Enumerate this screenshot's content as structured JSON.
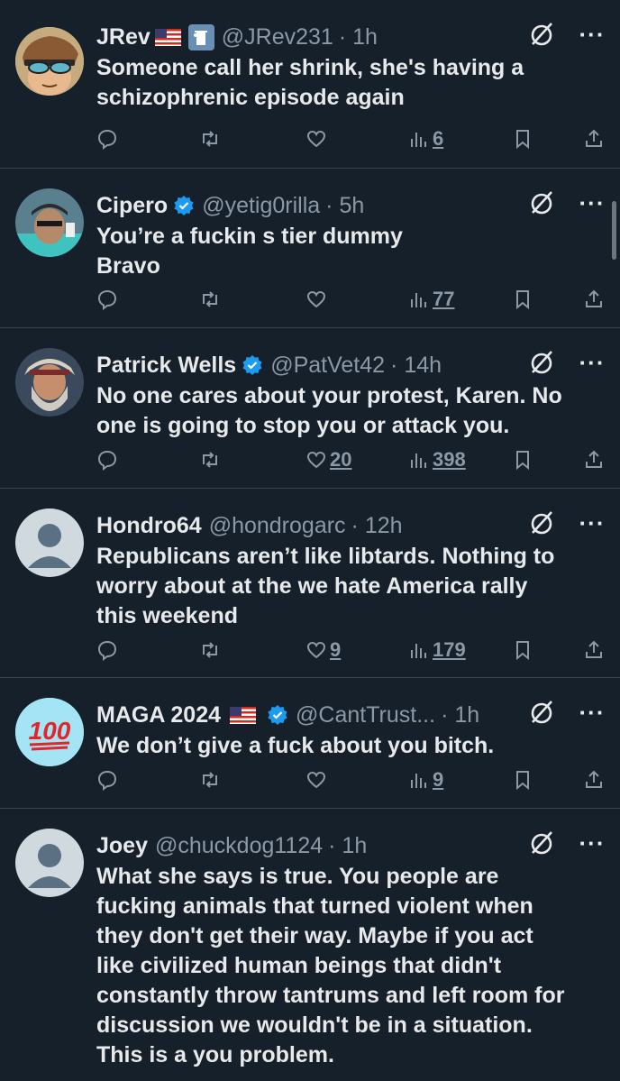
{
  "replies": [
    {
      "name": "JRev",
      "handle": "@JRev231",
      "time": "· 1h",
      "text": [
        "Someone call her shrink, she's having a",
        "schizophrenic episode again"
      ],
      "likes": "",
      "views": "6",
      "avatar": "cartoon-glasses-avatar"
    },
    {
      "name": "Cipero",
      "handle": "@yetig0rilla",
      "time": "· 5h",
      "text": [
        "You’re a fuckin s tier dummy",
        "Bravo"
      ],
      "likes": "",
      "views": "77",
      "avatar": "photo-avatar-cap"
    },
    {
      "name": "Patrick Wells",
      "handle": "@PatVet42",
      "time": "· 14h",
      "text": [
        "No one cares about your protest, Karen. No",
        "one is going to stop you or attack you."
      ],
      "likes": "20",
      "views": "398",
      "avatar": "photo-avatar-bearded"
    },
    {
      "name": "Hondro64",
      "handle": "@hondrogarc",
      "time": "· 12h",
      "text": [
        "Republicans aren’t like libtards. Nothing to",
        "worry about at the we hate America rally",
        "this weekend"
      ],
      "likes": "9",
      "views": "179",
      "avatar": "default-avatar"
    },
    {
      "name": "MAGA 2024",
      "handle": "@CantTrust...",
      "time": "· 1h",
      "text": [
        "We don’t give a fuck about you bitch."
      ],
      "likes": "",
      "views": "9",
      "avatar": "hundred-emoji-avatar",
      "avatar_text": "100"
    },
    {
      "name": "Joey",
      "handle": "@chuckdog1124",
      "time": "· 1h",
      "text": [
        "What she says is true. You people are",
        "fucking animals that turned violent when",
        "they don't get their way. Maybe if you act",
        "like civilized human beings that didn't",
        "constantly throw tantrums and left room for",
        "discussion we wouldn't be in a situation.",
        "This is a you problem."
      ],
      "likes": "",
      "views": "",
      "avatar": "default-avatar"
    }
  ],
  "colors": {
    "background": "#15202b",
    "text": "#e7e9ea",
    "muted": "#8b98a5",
    "verified": "#1d9bf0",
    "divider": "#38444d"
  }
}
